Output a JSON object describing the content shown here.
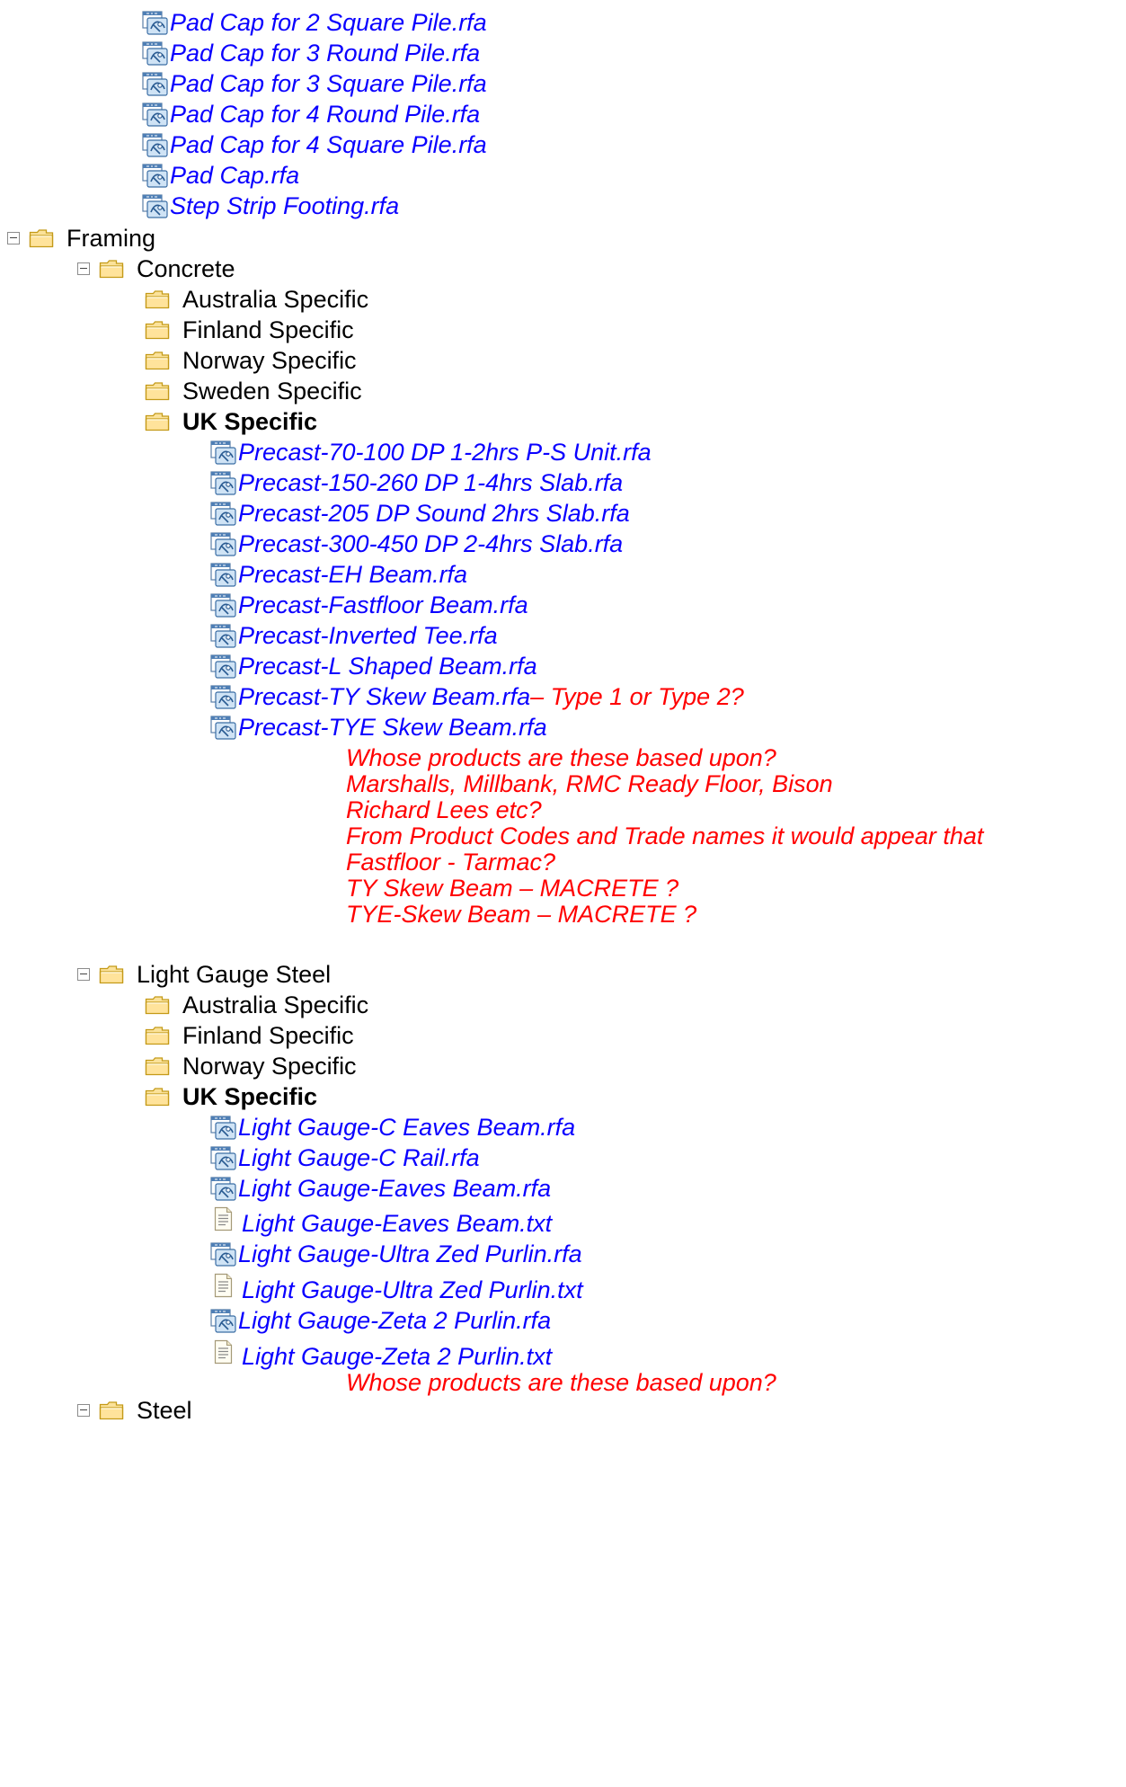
{
  "top_files": [
    "Pad Cap for 2 Square Pile.rfa",
    "Pad Cap for 3 Round Pile.rfa",
    "Pad Cap for 3 Square Pile.rfa",
    "Pad Cap for 4 Round Pile.rfa",
    "Pad Cap for 4 Square Pile.rfa",
    "Pad Cap.rfa",
    "Step Strip Footing.rfa"
  ],
  "framing": {
    "label": "Framing",
    "concrete": {
      "label": "Concrete",
      "folders": [
        "Australia Specific",
        "Finland Specific",
        "Norway Specific",
        "Sweden Specific"
      ],
      "uk_label": "UK Specific",
      "uk_files": [
        "Precast-70-100 DP 1-2hrs P-S Unit.rfa",
        "Precast-150-260 DP 1-4hrs Slab.rfa",
        "Precast-205 DP Sound 2hrs Slab.rfa",
        "Precast-300-450 DP 2-4hrs Slab.rfa",
        "Precast-EH Beam.rfa",
        "Precast-Fastfloor Beam.rfa",
        "Precast-Inverted Tee.rfa",
        "Precast-L Shaped Beam.rfa",
        "Precast-TY Skew Beam.rfa",
        "Precast-TYE Skew Beam.rfa"
      ],
      "ty_skew_note": " – Type 1 or Type 2?",
      "notes": [
        "Whose products are these based upon?",
        "Marshalls, Millbank, RMC Ready Floor, Bison",
        "Richard Lees etc?",
        "From Product Codes and Trade names it would appear that",
        "Fastfloor - Tarmac?",
        "TY Skew Beam – MACRETE ?",
        "TYE-Skew Beam – MACRETE ?"
      ]
    },
    "light_gauge": {
      "label": "Light Gauge Steel",
      "folders": [
        "Australia Specific",
        "Finland Specific",
        "Norway Specific"
      ],
      "uk_label": "UK Specific",
      "uk_files": [
        {
          "name": "Light Gauge-C Eaves Beam.rfa",
          "kind": "rfa"
        },
        {
          "name": "Light Gauge-C Rail.rfa",
          "kind": "rfa"
        },
        {
          "name": "Light Gauge-Eaves Beam.rfa",
          "kind": "rfa"
        },
        {
          "name": "Light Gauge-Eaves Beam.txt",
          "kind": "txt"
        },
        {
          "name": "Light Gauge-Ultra Zed Purlin.rfa",
          "kind": "rfa"
        },
        {
          "name": "Light Gauge-Ultra Zed Purlin.txt",
          "kind": "txt"
        },
        {
          "name": "Light Gauge-Zeta 2 Purlin.rfa",
          "kind": "rfa"
        },
        {
          "name": "Light Gauge-Zeta 2 Purlin.txt",
          "kind": "txt"
        }
      ],
      "note": "Whose products are these based upon?"
    },
    "steel": {
      "label": "Steel"
    }
  },
  "icons": {
    "folder": "folder-icon",
    "rfa": "revit-family-icon",
    "txt": "text-file-icon",
    "toggle": "collapse-toggle-icon"
  },
  "colors": {
    "link": "#0a00ff",
    "note": "#ff0000",
    "folder_fill": "#ffe9a8",
    "folder_stroke": "#b8860b"
  }
}
